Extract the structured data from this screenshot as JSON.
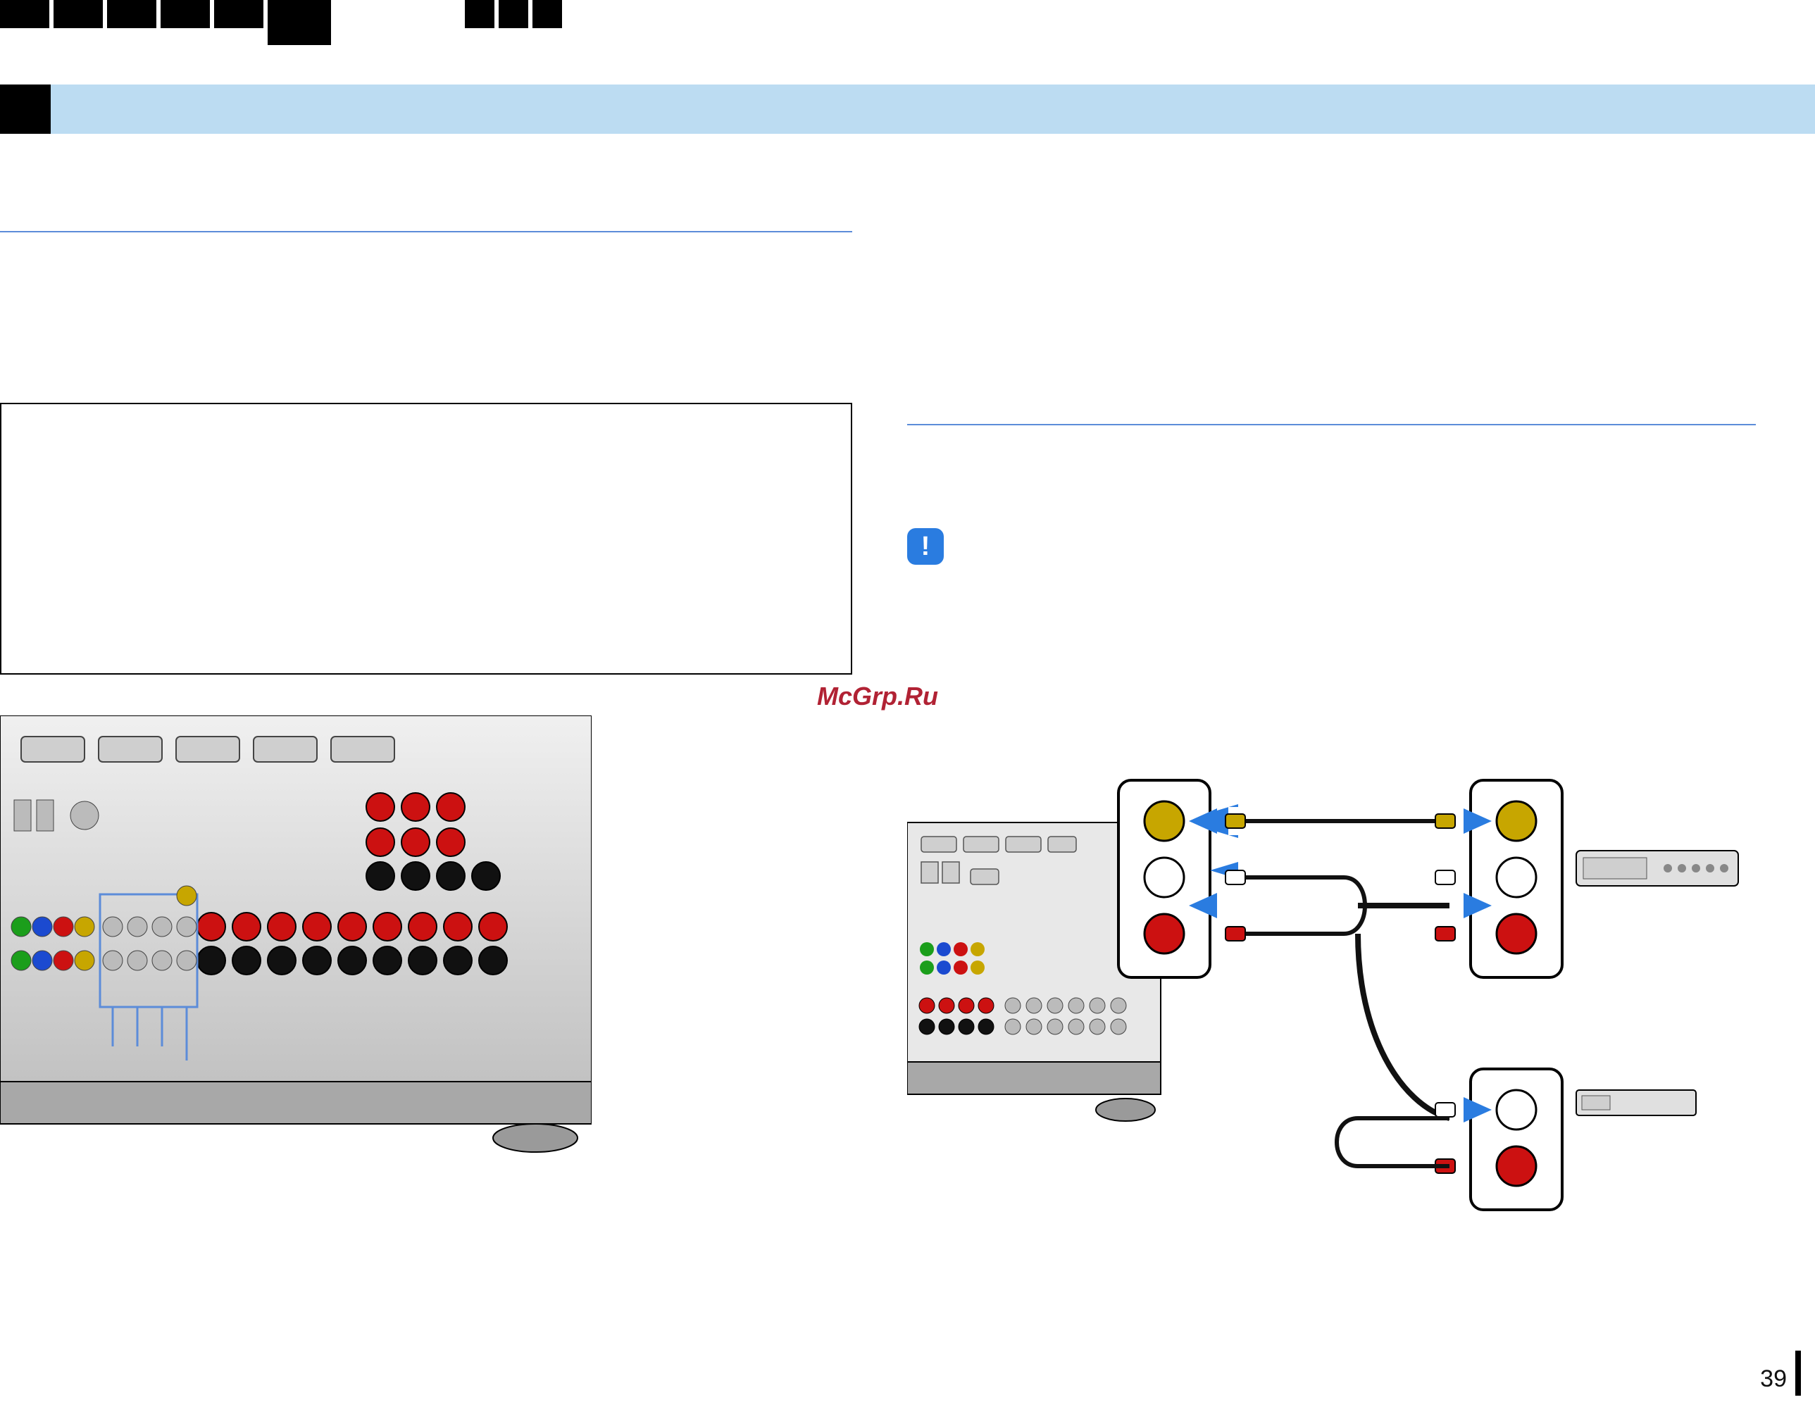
{
  "page_number": "39",
  "watermark": "McGrp.Ru",
  "note_glyph": "!"
}
